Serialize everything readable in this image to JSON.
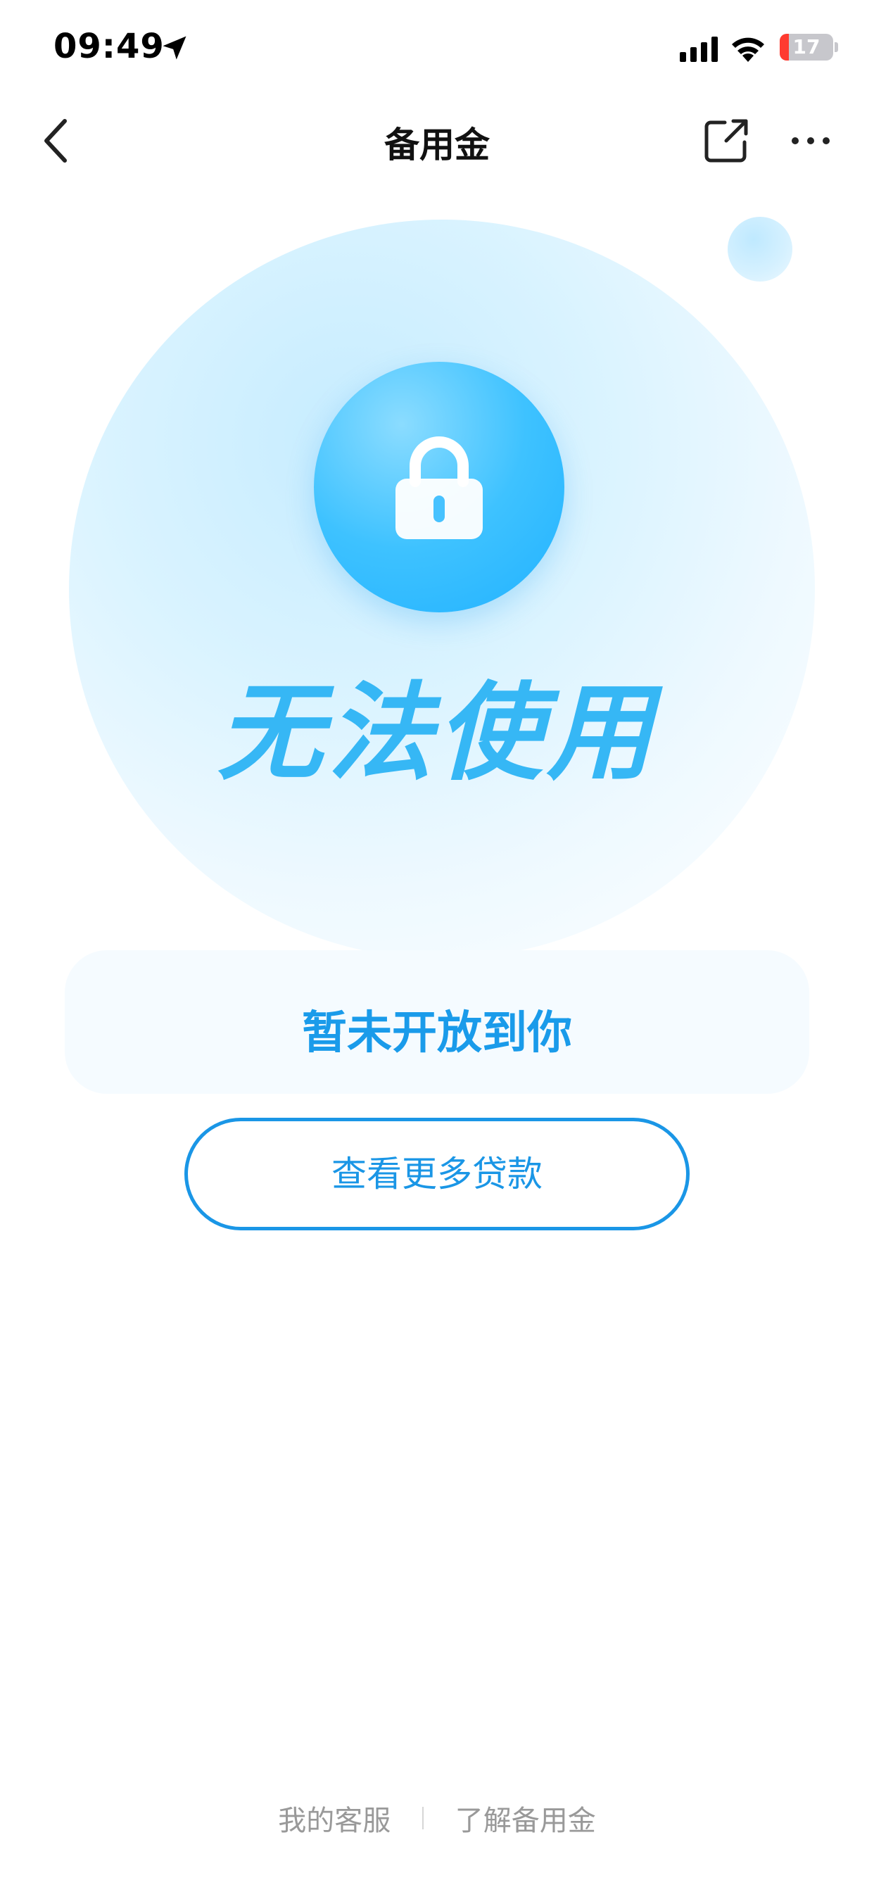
{
  "status_bar": {
    "time": "09:49",
    "battery_text": "17",
    "battery_level": 0.17,
    "icons": [
      "location-arrow-icon",
      "cellular-signal-icon",
      "wifi-icon",
      "battery-charging-icon"
    ]
  },
  "nav": {
    "title": "备用金",
    "icons": [
      "chevron-left-icon",
      "share-icon",
      "more-icon"
    ]
  },
  "hero": {
    "status_text": "无法使用",
    "icon": "lock-icon"
  },
  "notice": {
    "text": "暂未开放到你"
  },
  "actions": {
    "more_loans_label": "查看更多贷款"
  },
  "footer": {
    "customer_service": "我的客服",
    "learn_more": "了解备用金"
  },
  "colors": {
    "accent": "#1a96e6",
    "hero_text": "#36b7f5",
    "lock_circle": "#2fbaff",
    "battery_low": "#ff3b30",
    "footer_text": "#999999"
  }
}
